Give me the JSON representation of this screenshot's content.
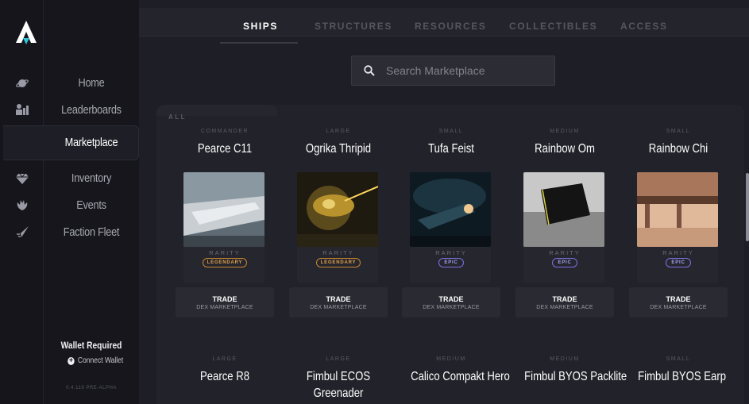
{
  "nav": {
    "items": [
      {
        "label": "Home",
        "icon": "planet-icon"
      },
      {
        "label": "Leaderboards",
        "icon": "podium-icon"
      },
      {
        "label": "Marketplace",
        "icon": "cart-icon"
      },
      {
        "label": "Inventory",
        "icon": "diamond-icon"
      },
      {
        "label": "Events",
        "icon": "faction-icon"
      },
      {
        "label": "Faction Fleet",
        "icon": "ship-icon"
      }
    ],
    "wallet_title": "Wallet Required",
    "wallet_connect": "Connect Wallet",
    "version": "0.4.119 PRE-ALPHA"
  },
  "tabs": [
    "SHIPS",
    "STRUCTURES",
    "RESOURCES",
    "COLLECTIBLES",
    "ACCESS"
  ],
  "search": {
    "placeholder": "Search Marketplace"
  },
  "filter_label": "ALL",
  "cards": [
    {
      "class": "COMMANDER",
      "name": "Pearce C11",
      "rarity_label": "RARITY",
      "rarity": "LEGENDARY",
      "trade": "TRADE",
      "trade_sub": "DEX MARKETPLACE"
    },
    {
      "class": "LARGE",
      "name": "Ogrika Thripid",
      "rarity_label": "RARITY",
      "rarity": "LEGENDARY",
      "trade": "TRADE",
      "trade_sub": "DEX MARKETPLACE"
    },
    {
      "class": "SMALL",
      "name": "Tufa Feist",
      "rarity_label": "RARITY",
      "rarity": "EPIC",
      "trade": "TRADE",
      "trade_sub": "DEX MARKETPLACE"
    },
    {
      "class": "MEDIUM",
      "name": "Rainbow Om",
      "rarity_label": "RARITY",
      "rarity": "EPIC",
      "trade": "TRADE",
      "trade_sub": "DEX MARKETPLACE"
    },
    {
      "class": "SMALL",
      "name": "Rainbow Chi",
      "rarity_label": "RARITY",
      "rarity": "EPIC",
      "trade": "TRADE",
      "trade_sub": "DEX MARKETPLACE"
    },
    {
      "class": "LARGE",
      "name": "Pearce R8"
    },
    {
      "class": "LARGE",
      "name": "Fimbul ECOS Greenader"
    },
    {
      "class": "MEDIUM",
      "name": "Calico Compakt Hero"
    },
    {
      "class": "MEDIUM",
      "name": "Fimbul BYOS Packlite"
    },
    {
      "class": "SMALL",
      "name": "Fimbul BYOS Earp"
    }
  ],
  "colors": {
    "legendary": "#c8862e",
    "epic": "#7a72e0",
    "accent": "#2ec4d6"
  }
}
